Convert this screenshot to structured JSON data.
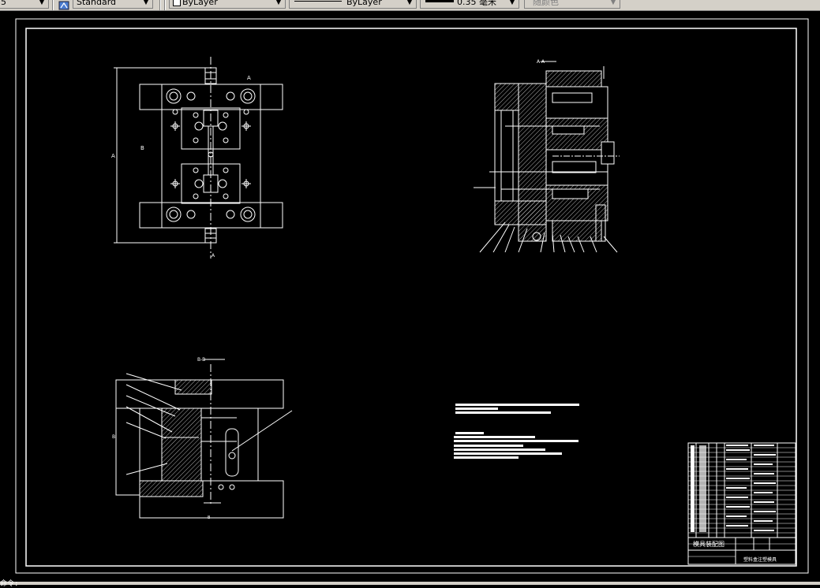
{
  "toolbar": {
    "partial_left_label": "5",
    "text_style": "Standard",
    "layer": "ByLayer",
    "linetype": "ByLayer",
    "lineweight": "0.35 毫米",
    "plot_style": "随颜色"
  },
  "command_line": {
    "prompt": "命令:"
  },
  "drawing": {
    "top_view": {
      "cut_marks": [
        "A",
        "A"
      ]
    },
    "section_view": {
      "label": "A-A",
      "balloon_count": 12
    },
    "lower_view": {
      "label": "B-B"
    },
    "notes_block": {
      "title_present": true
    },
    "title_block": {
      "title": "模具装配图",
      "drawing_name": "塑料盒注塑模具"
    }
  },
  "colors": {
    "background": "#000000",
    "lines": "#ffffff",
    "toolbar": "#d4d0c8"
  }
}
